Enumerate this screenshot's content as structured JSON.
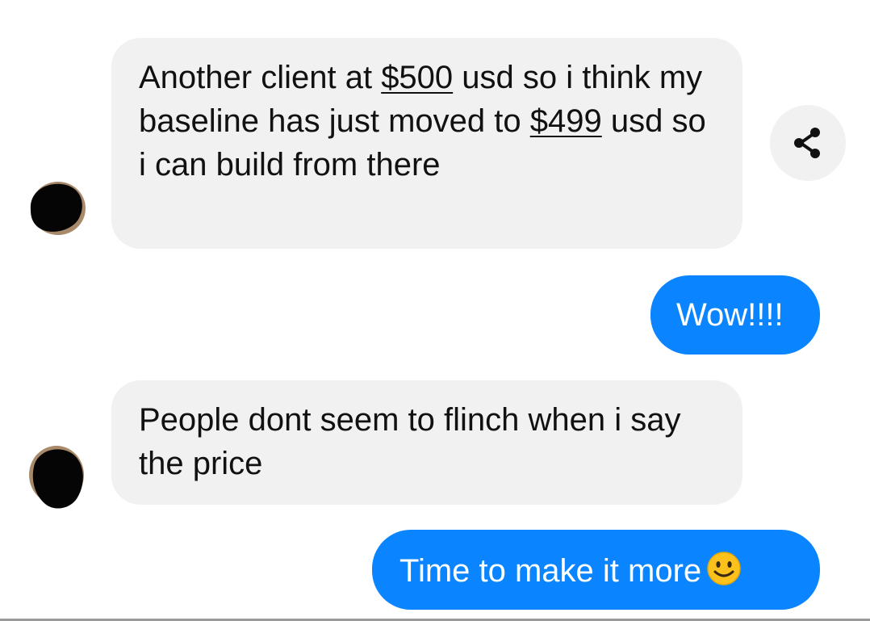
{
  "messages": [
    {
      "direction": "incoming",
      "parts": [
        {
          "text": "Another client at "
        },
        {
          "text": "$500",
          "underline": true
        },
        {
          "text": " usd so i think my baseline has just moved to "
        },
        {
          "text": "$499",
          "underline": true
        },
        {
          "text": " usd so i can build from there"
        }
      ]
    },
    {
      "direction": "outgoing",
      "text": "Wow!!!!"
    },
    {
      "direction": "incoming",
      "text": "People dont seem to flinch when i say the price"
    },
    {
      "direction": "outgoing",
      "text": "Time to make it more",
      "emoji": "slightly-smiling-face"
    }
  ],
  "icons": {
    "share": "share-icon",
    "emoji": "smiley-emoji-icon"
  },
  "colors": {
    "incoming_bubble": "#f1f1f1",
    "outgoing_bubble": "#0a84ff",
    "incoming_text": "#111111",
    "outgoing_text": "#ffffff"
  }
}
